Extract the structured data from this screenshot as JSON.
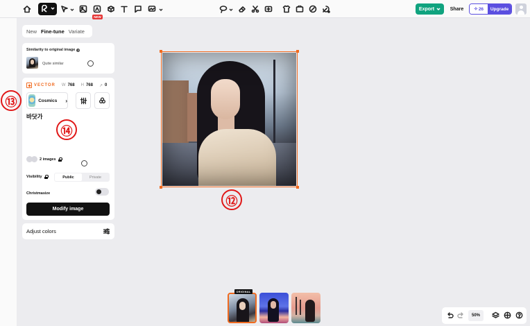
{
  "toolbar": {
    "new_badge": "NEW",
    "export_label": "Export",
    "share_label": "Share",
    "credits": "26",
    "upgrade_label": "Upgrade"
  },
  "panel": {
    "tabs": [
      {
        "label": "New",
        "active": false
      },
      {
        "label": "Fine-tune",
        "active": true
      },
      {
        "label": "Variate",
        "active": false
      }
    ],
    "similarity": {
      "title": "Similarity to original image",
      "help_glyph": "?",
      "option_label": "Quite similar"
    },
    "vector": {
      "label": "VECTOR",
      "w_label": "W",
      "w_value": "768",
      "h_label": "H",
      "h_value": "768",
      "extra_label": "↗",
      "extra_value": "0"
    },
    "style": {
      "name": "Cosmics",
      "arrow": "›"
    },
    "prompt": "바닷가",
    "images_label": "2 images",
    "visibility": {
      "label": "Visibility",
      "options": [
        "Public",
        "Private"
      ],
      "selected": "Public"
    },
    "christmasize_label": "Christmasize",
    "modify_label": "Modify image",
    "adjust_label": "Adjust colors"
  },
  "callouts": {
    "c12": "⑫",
    "c13": "⑬",
    "c14": "⑭"
  },
  "thumbstrip": {
    "original_badge": "ORIGINAL"
  },
  "bottom": {
    "zoom": "50%"
  },
  "colors": {
    "accent_orange": "#f06a1f",
    "export_green": "#10a37f",
    "upgrade_purple": "#5b4fe0",
    "callout_red": "#e01717"
  }
}
